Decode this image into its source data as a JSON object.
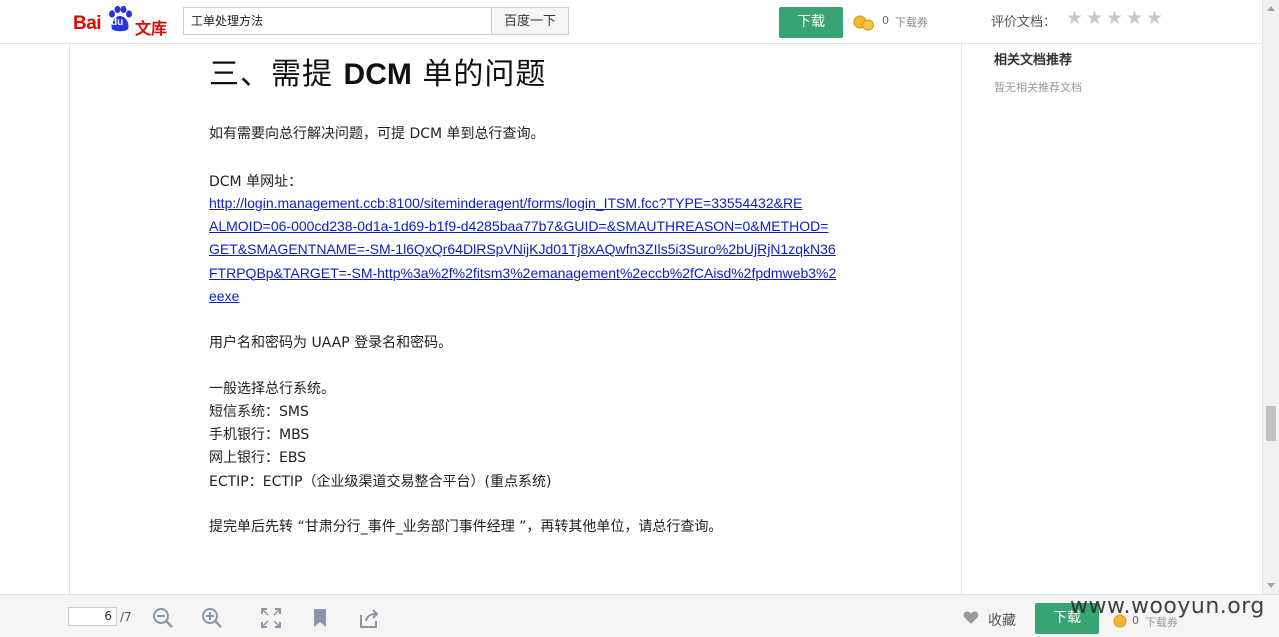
{
  "header": {
    "logo_text": "Bai du 文库",
    "search_value": "工单处理方法",
    "search_button": "百度一下",
    "download_button": "下载",
    "coin_count": "0",
    "coin_label": "下载券",
    "rate_label": "评价文档：",
    "rating": 0
  },
  "document": {
    "heading_prefix": "三、需提 ",
    "heading_bold": "DCM",
    "heading_suffix": " 单的问题",
    "p1": "如有需要向总行解决问题，可提 DCM 单到总行查询。",
    "url_label": "DCM 单网址：",
    "url_lines": [
      "http://login.management.ccb:8100/siteminderagent/forms/login_ITSM.fcc?TYPE=33554432&RE",
      "ALMOID=06-000cd238-0d1a-1d69-b1f9-d4285baa77b7&GUID=&SMAUTHREASON=0&METHOD=",
      "GET&SMAGENTNAME=-SM-1l6QxQr64DlRSpVNijKJd01Tj8xAQwfn3ZIls5i3Suro%2bUjRjN1zqkN36",
      "FTRPQBp&TARGET=-SM-http%3a%2f%2fitsm3%2emanagement%2eccb%2fCAisd%2fpdmweb3%2",
      "eexe"
    ],
    "p_login": "用户名和密码为 UAAP 登录名和密码。",
    "p_select": "一般选择总行系统。",
    "p_sms": "短信系统：SMS",
    "p_mbs": "手机银行：MBS",
    "p_ebs": "网上银行：EBS",
    "p_ectip": "ECTIP：ECTIP（企业级渠道交易整合平台）(重点系统)",
    "p_after": "提完单后先转 “甘肃分行_事件_业务部门事件经理 ”，再转其他单位，请总行查询。"
  },
  "sidebar": {
    "title": "相关文档推荐",
    "empty_text": "暂无相关推荐文档"
  },
  "footer": {
    "page_current": "6",
    "page_total": "/7",
    "favorite_label": "收藏",
    "download_button": "下载",
    "coin_count": "0",
    "coin_label": "下载券",
    "watermark": "www.wooyun.org"
  },
  "colors": {
    "download_green": "#38a373",
    "link_blue": "#0b1fc4",
    "brand_red": "#e10601"
  },
  "icons": [
    "baidu-paw-icon",
    "coin-icon",
    "star-icon",
    "zoom-out-icon",
    "zoom-in-icon",
    "fullscreen-icon",
    "bookmark-icon",
    "share-icon",
    "heart-icon"
  ]
}
